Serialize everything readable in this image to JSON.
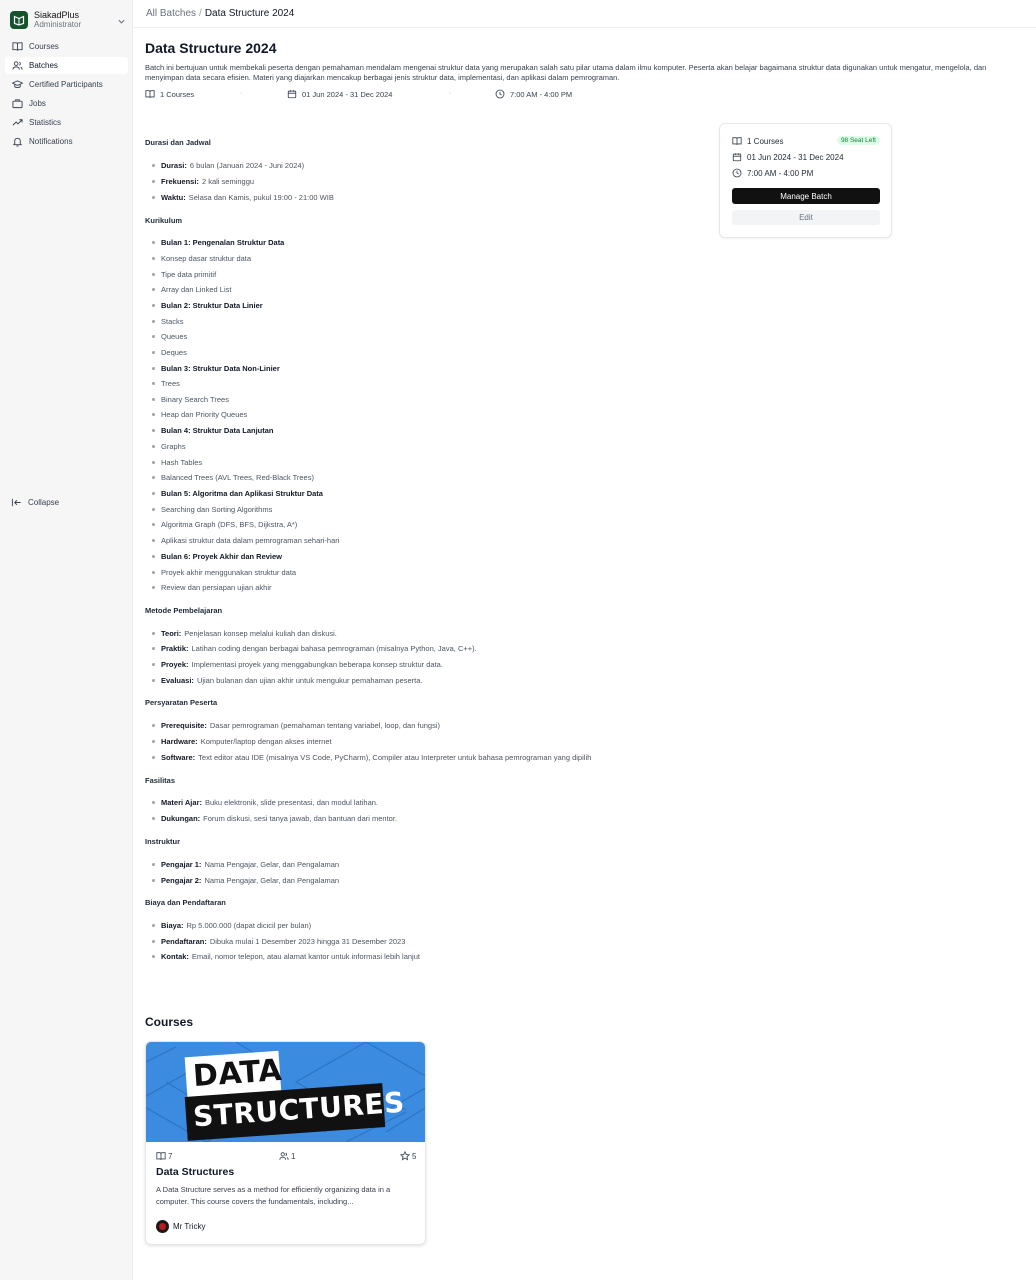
{
  "app": {
    "name": "SiakadPlus",
    "role": "Administrator"
  },
  "sidebar": {
    "items": [
      {
        "label": "Courses",
        "icon": "book-icon",
        "active": false
      },
      {
        "label": "Batches",
        "icon": "users-icon",
        "active": true
      },
      {
        "label": "Certified Participants",
        "icon": "graduation-cap-icon",
        "active": false
      },
      {
        "label": "Jobs",
        "icon": "briefcase-icon",
        "active": false
      },
      {
        "label": "Statistics",
        "icon": "trending-up-icon",
        "active": false
      },
      {
        "label": "Notifications",
        "icon": "bell-icon",
        "active": false
      }
    ],
    "collapse_label": "Collapse"
  },
  "breadcrumb": {
    "parent": "All Batches",
    "separator": "/",
    "current": "Data Structure 2024"
  },
  "batch": {
    "title": "Data Structure 2024",
    "description": "Batch ini bertujuan untuk membekali peserta dengan pemahaman mendalam mengenai struktur data yang merupakan salah satu pilar utama dalam ilmu komputer. Peserta akan belajar bagaimana struktur data digunakan untuk mengatur, mengelola, dan menyimpan data secara efisien. Materi yang diajarkan mencakup berbagai jenis struktur data, implementasi, dan aplikasi dalam pemrograman.",
    "courses_count": "1 Courses",
    "date_range": "01 Jun 2024 - 31 Dec 2024",
    "time_range": "7:00 AM - 4:00 PM",
    "separator": "·"
  },
  "details": {
    "durasi": {
      "heading": "Durasi dan Jadwal",
      "items": [
        {
          "label": "Durasi:",
          "text": "6 bulan (Januari 2024 - Juni 2024)"
        },
        {
          "label": "Frekuensi:",
          "text": "2 kali seminggu"
        },
        {
          "label": "Waktu:",
          "text": "Selasa dan Kamis, pukul 19:00 - 21:00 WIB"
        }
      ]
    },
    "kurikulum": {
      "heading": "Kurikulum",
      "items": [
        "Bulan 1: Pengenalan Struktur Data",
        "Konsep dasar struktur data",
        "Tipe data primitif",
        "Array dan Linked List",
        "Bulan 2: Struktur Data Linier",
        "Stacks",
        "Queues",
        "Deques",
        "Bulan 3: Struktur Data Non-Linier",
        "Trees",
        "Binary Search Trees",
        "Heap dan Priority Queues",
        "Bulan 4: Struktur Data Lanjutan",
        "Graphs",
        "Hash Tables",
        "Balanced Trees (AVL Trees, Red-Black Trees)",
        "Bulan 5: Algoritma dan Aplikasi Struktur Data",
        "Searching dan Sorting Algorithms",
        "Algoritma Graph (DFS, BFS, Dijkstra, A*)",
        "Aplikasi struktur data dalam pemrograman sehari-hari",
        "Bulan 6: Proyek Akhir dan Review",
        "Proyek akhir menggunakan struktur data",
        "Review dan persiapan ujian akhir"
      ]
    },
    "metode": {
      "heading": "Metode Pembelajaran",
      "items": [
        {
          "label": "Teori:",
          "text": "Penjelasan konsep melalui kuliah dan diskusi."
        },
        {
          "label": "Praktik:",
          "text": "Latihan coding dengan berbagai bahasa pemrograman (misalnya Python, Java, C++)."
        },
        {
          "label": "Proyek:",
          "text": "Implementasi proyek yang menggabungkan beberapa konsep struktur data."
        },
        {
          "label": "Evaluasi:",
          "text": "Ujian bulanan dan ujian akhir untuk mengukur pemahaman peserta."
        }
      ]
    },
    "persyaratan": {
      "heading": "Persyaratan Peserta",
      "items": [
        {
          "label": "Prerequisite:",
          "text": "Dasar pemrograman (pemahaman tentang variabel, loop, dan fungsi)"
        },
        {
          "label": "Hardware:",
          "text": "Komputer/laptop dengan akses internet"
        },
        {
          "label": "Software:",
          "text": "Text editor atau IDE (misalnya VS Code, PyCharm), Compiler atau Interpreter untuk bahasa pemrograman yang dipilih"
        }
      ]
    },
    "fasilitas": {
      "heading": "Fasilitas",
      "items": [
        {
          "label": "Materi Ajar:",
          "text": "Buku elektronik, slide presentasi, dan modul latihan."
        },
        {
          "label": "Dukungan:",
          "text": "Forum diskusi, sesi tanya jawab, dan bantuan dari mentor."
        }
      ]
    },
    "instruktur": {
      "heading": "Instruktur",
      "items": [
        {
          "label": "Pengajar 1:",
          "text": "Nama Pengajar, Gelar, dan Pengalaman"
        },
        {
          "label": "Pengajar 2:",
          "text": "Nama Pengajar, Gelar, dan Pengalaman"
        }
      ]
    },
    "biaya": {
      "heading": "Biaya dan Pendaftaran",
      "items": [
        {
          "label": "Biaya:",
          "text": "Rp 5.000.000 (dapat dicicil per bulan)"
        },
        {
          "label": "Pendaftaran:",
          "text": "Dibuka mulai 1 Desember 2023 hingga 31 Desember 2023"
        },
        {
          "label": "Kontak:",
          "text": "Email, nomor telepon, atau alamat kantor untuk informasi lebih lanjut"
        }
      ]
    }
  },
  "summary_card": {
    "courses": "1 Courses",
    "seat_badge": "98 Seat Left",
    "date_range": "01 Jun 2024 - 31 Dec 2024",
    "time_range": "7:00 AM - 4:00 PM",
    "manage_label": "Manage Batch",
    "edit_label": "Edit"
  },
  "courses_section": {
    "heading": "Courses",
    "items": [
      {
        "thumbnail_line1": "DATA",
        "thumbnail_line2": "STRUCTURES",
        "lessons": "7",
        "students": "1",
        "rating": "5",
        "title": "Data Structures",
        "description": "A Data Structure serves as a method for efficiently organizing data in a computer. This course covers the fundamentals, including...",
        "author": "Mr Tricky"
      }
    ]
  },
  "colors": {
    "brand": "#14532d",
    "primary_button": "#111111",
    "seat_badge_bg": "#dcfce7",
    "seat_badge_text": "#15803d",
    "thumbnail_bg": "#3b8ce0"
  }
}
